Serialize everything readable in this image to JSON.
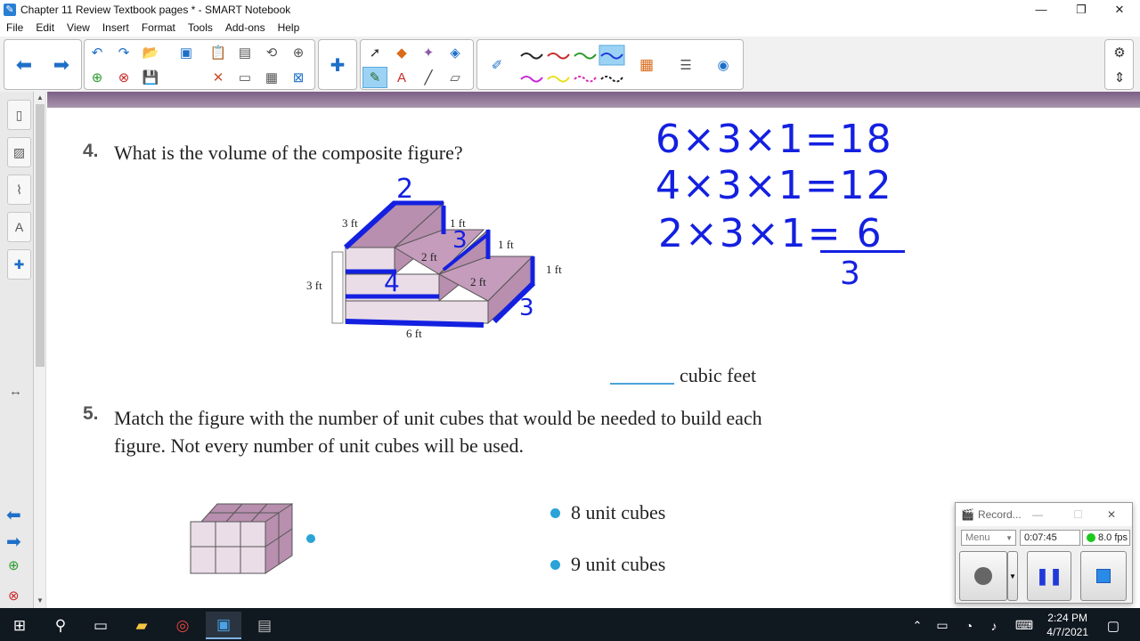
{
  "window": {
    "title": "Chapter 11 Review Textbook pages * - SMART Notebook"
  },
  "menu": [
    "File",
    "Edit",
    "View",
    "Insert",
    "Format",
    "Tools",
    "Add-ons",
    "Help"
  ],
  "question4": {
    "number": "4.",
    "text": "What is the volume of the composite figure?",
    "answer_unit": "cubic feet",
    "figure_labels": [
      "3 ft",
      "1 ft",
      "1 ft",
      "1 ft",
      "2 ft",
      "2 ft",
      "3 ft",
      "6 ft"
    ]
  },
  "handwriting": {
    "line1": "6×3×1=18",
    "line2": "4×3×1=12",
    "line3": "2×3×1= 6",
    "line4": "3",
    "marks": [
      "2",
      "3",
      "4",
      "3"
    ]
  },
  "question5": {
    "number": "5.",
    "text": "Match the figure with the number of unit cubes that would be needed to build each figure. Not every number of unit cubes will be used.",
    "options": [
      "8 unit cubes",
      "9 unit cubes"
    ]
  },
  "recorder": {
    "title": "Record...",
    "menu_label": "Menu",
    "elapsed": "0:07:45",
    "fps": "8.0 fps"
  },
  "taskbar": {
    "time": "2:24 PM",
    "date": "4/7/2021"
  },
  "colors": {
    "ink": "#1420e0",
    "figure_purple": "#b88fae",
    "accent_blue": "#2aa3d8"
  }
}
